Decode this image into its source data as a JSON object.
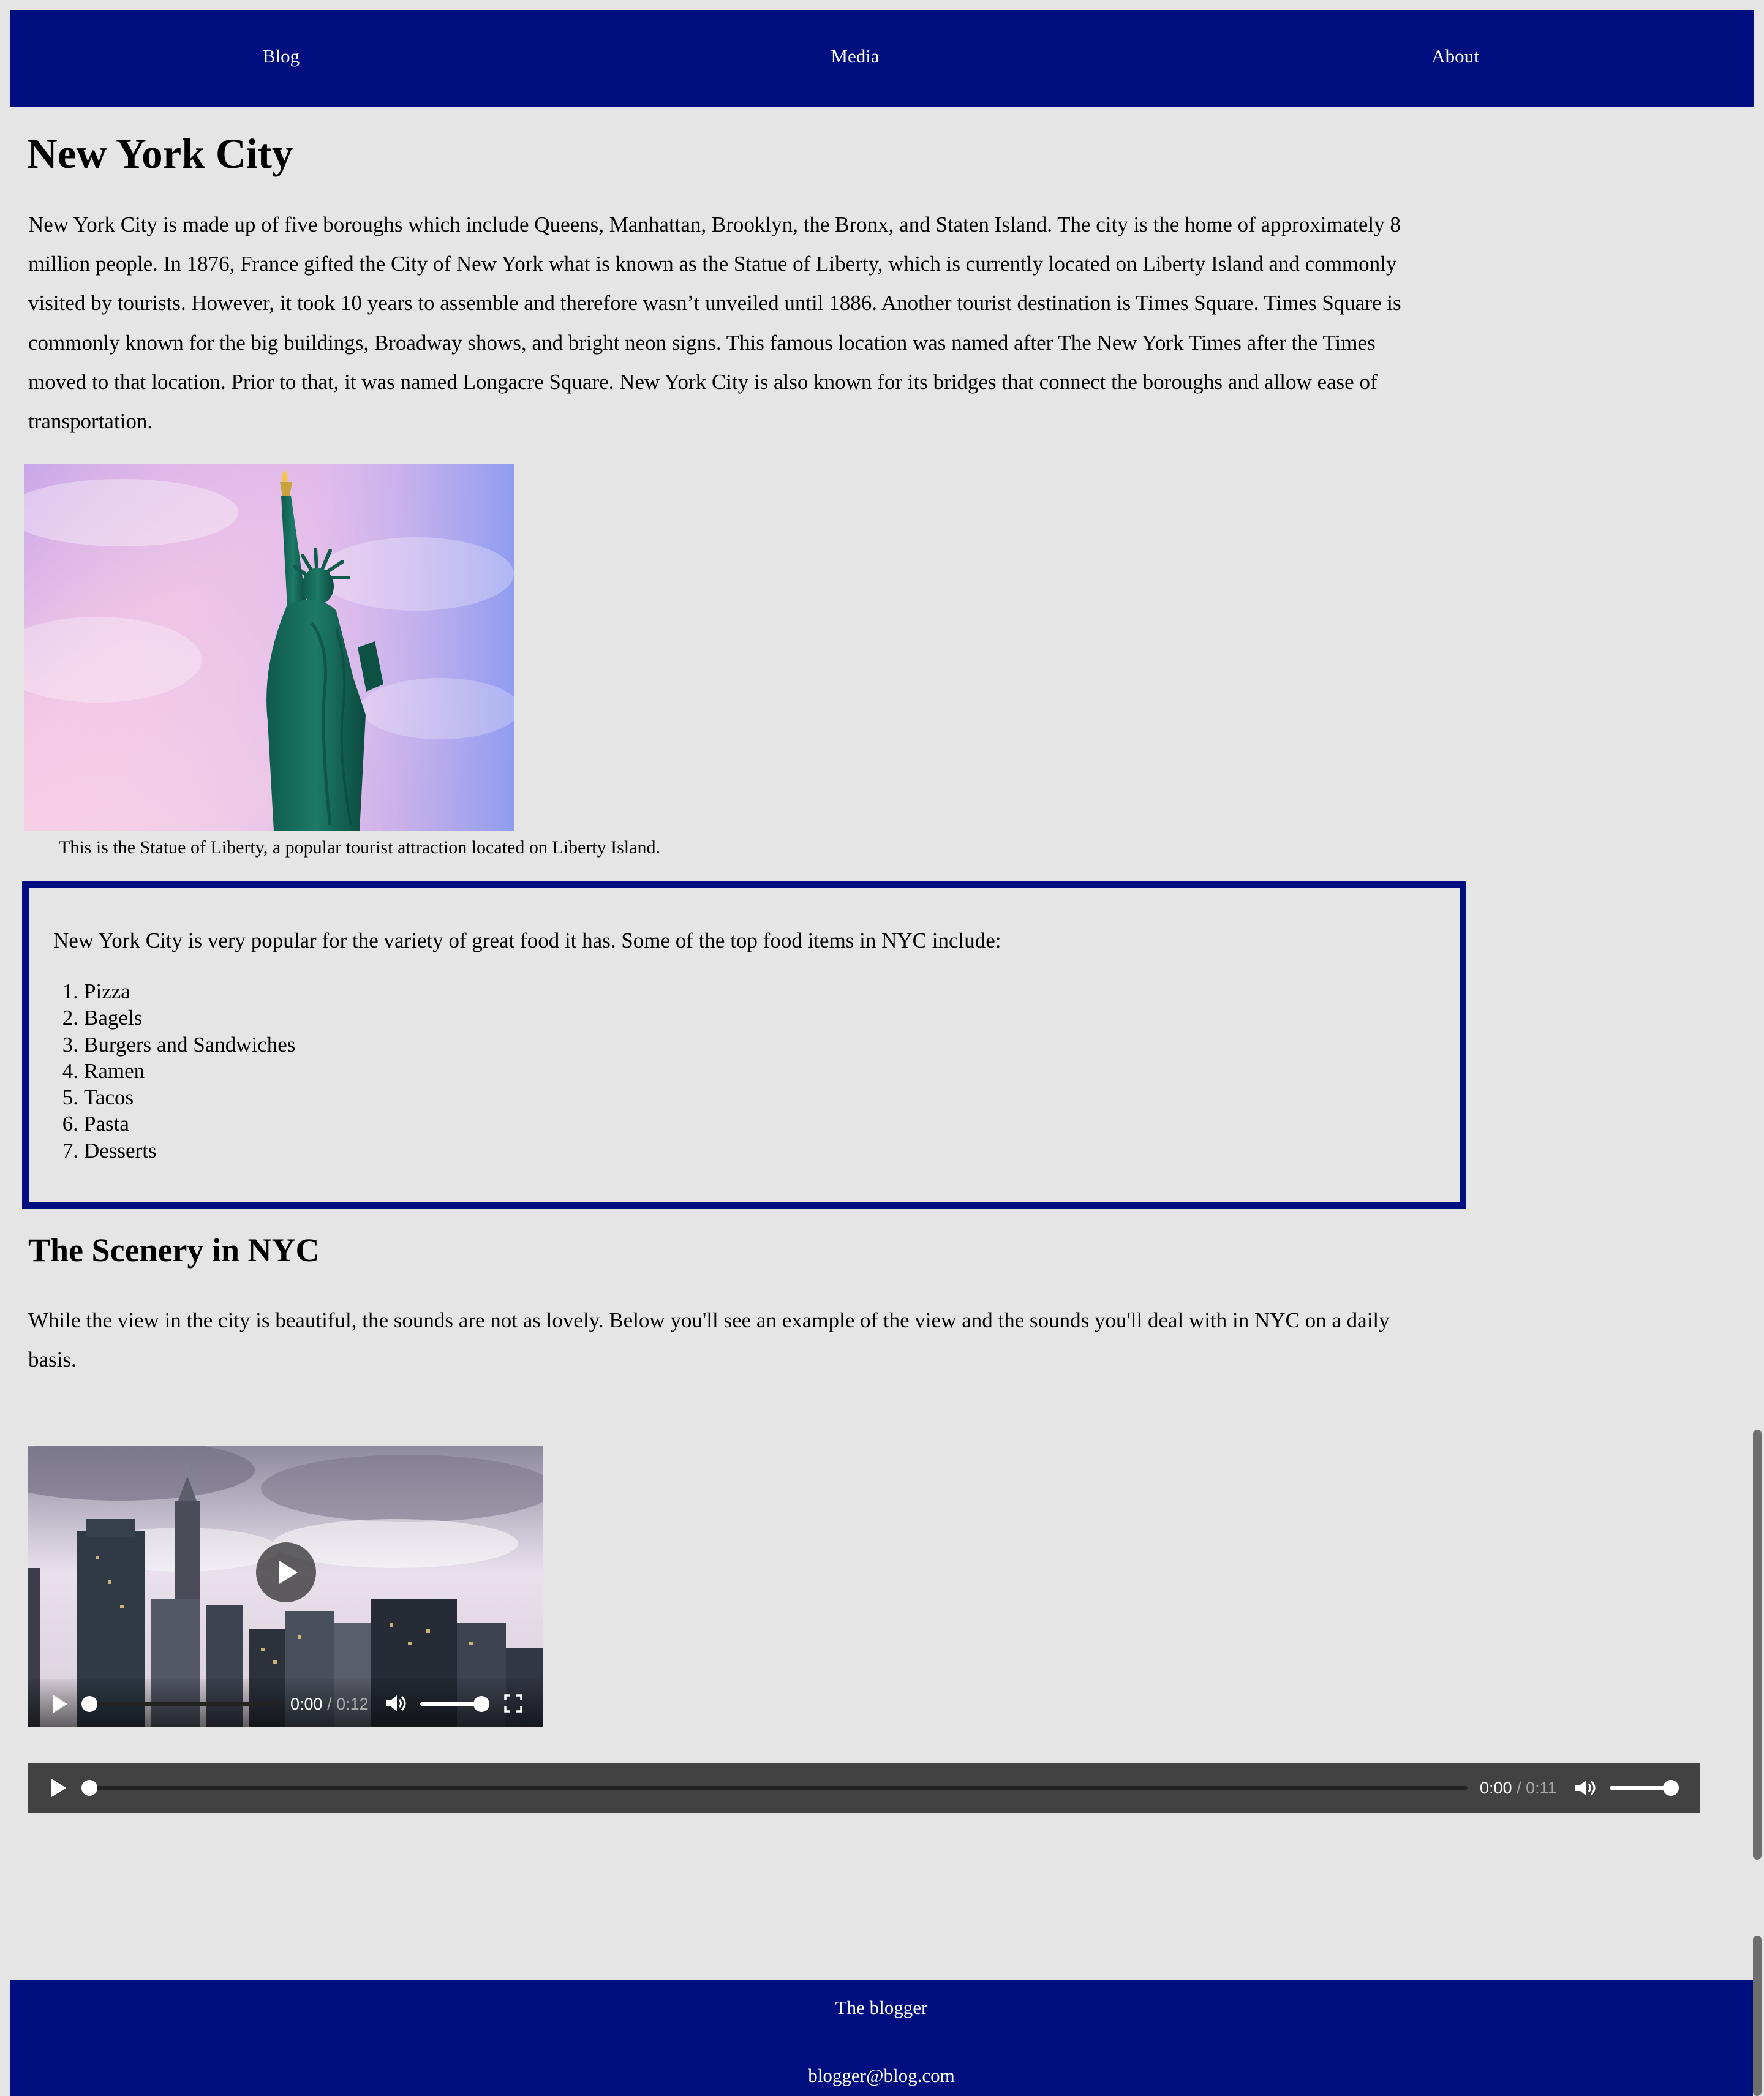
{
  "nav": {
    "items": [
      {
        "label": "Blog"
      },
      {
        "label": "Media"
      },
      {
        "label": "About"
      }
    ]
  },
  "main": {
    "title": "New York City",
    "intro": "New York City is made up of five boroughs which include Queens, Manhattan, Brooklyn, the Bronx, and Staten Island. The city is the home of approximately 8 million people. In 1876, France gifted the City of New York what is known as the Statue of Liberty, which is currently located on Liberty Island and commonly visited by tourists. However, it took 10 years to assemble and therefore wasn’t unveiled until 1886. Another tourist destination is Times Square. Times Square is commonly known for the big buildings, Broadway shows, and bright neon signs. This famous location was named after The New York Times after the Times moved to that location. Prior to that, it was named Longacre Square. New York City is also known for its bridges that connect the boroughs and allow ease of transportation.",
    "figure": {
      "caption": "This is the Statue of Liberty, a popular tourist attraction located on Liberty Island."
    },
    "food": {
      "intro": "New York City is very popular for the variety of great food it has. Some of the top food items in NYC include:",
      "items": [
        {
          "num": "1.",
          "label": "Pizza"
        },
        {
          "num": "2.",
          "label": "Bagels"
        },
        {
          "num": "3.",
          "label": "Burgers and Sandwiches"
        },
        {
          "num": "4.",
          "label": "Ramen"
        },
        {
          "num": "5.",
          "label": "Tacos"
        },
        {
          "num": "6.",
          "label": "Pasta"
        },
        {
          "num": "7.",
          "label": "Desserts"
        }
      ]
    },
    "scenery": {
      "heading": "The Scenery in NYC",
      "text": "While the view in the city is beautiful, the sounds are not as lovely. Below you'll see an example of the view and the sounds you'll deal with in NYC on a daily basis."
    },
    "video": {
      "current_time": "0:00",
      "duration": "/ 0:12",
      "progress": 0,
      "volume": 1.0
    },
    "audio": {
      "current_time": "0:00",
      "duration": "/ 0:11",
      "progress": 0,
      "volume": 1.0
    }
  },
  "footer": {
    "name": "The blogger",
    "email": "blogger@blog.com"
  },
  "colors": {
    "brand": "#000f80",
    "page_bg": "#e5e5e5",
    "player_bg": "#424242"
  }
}
